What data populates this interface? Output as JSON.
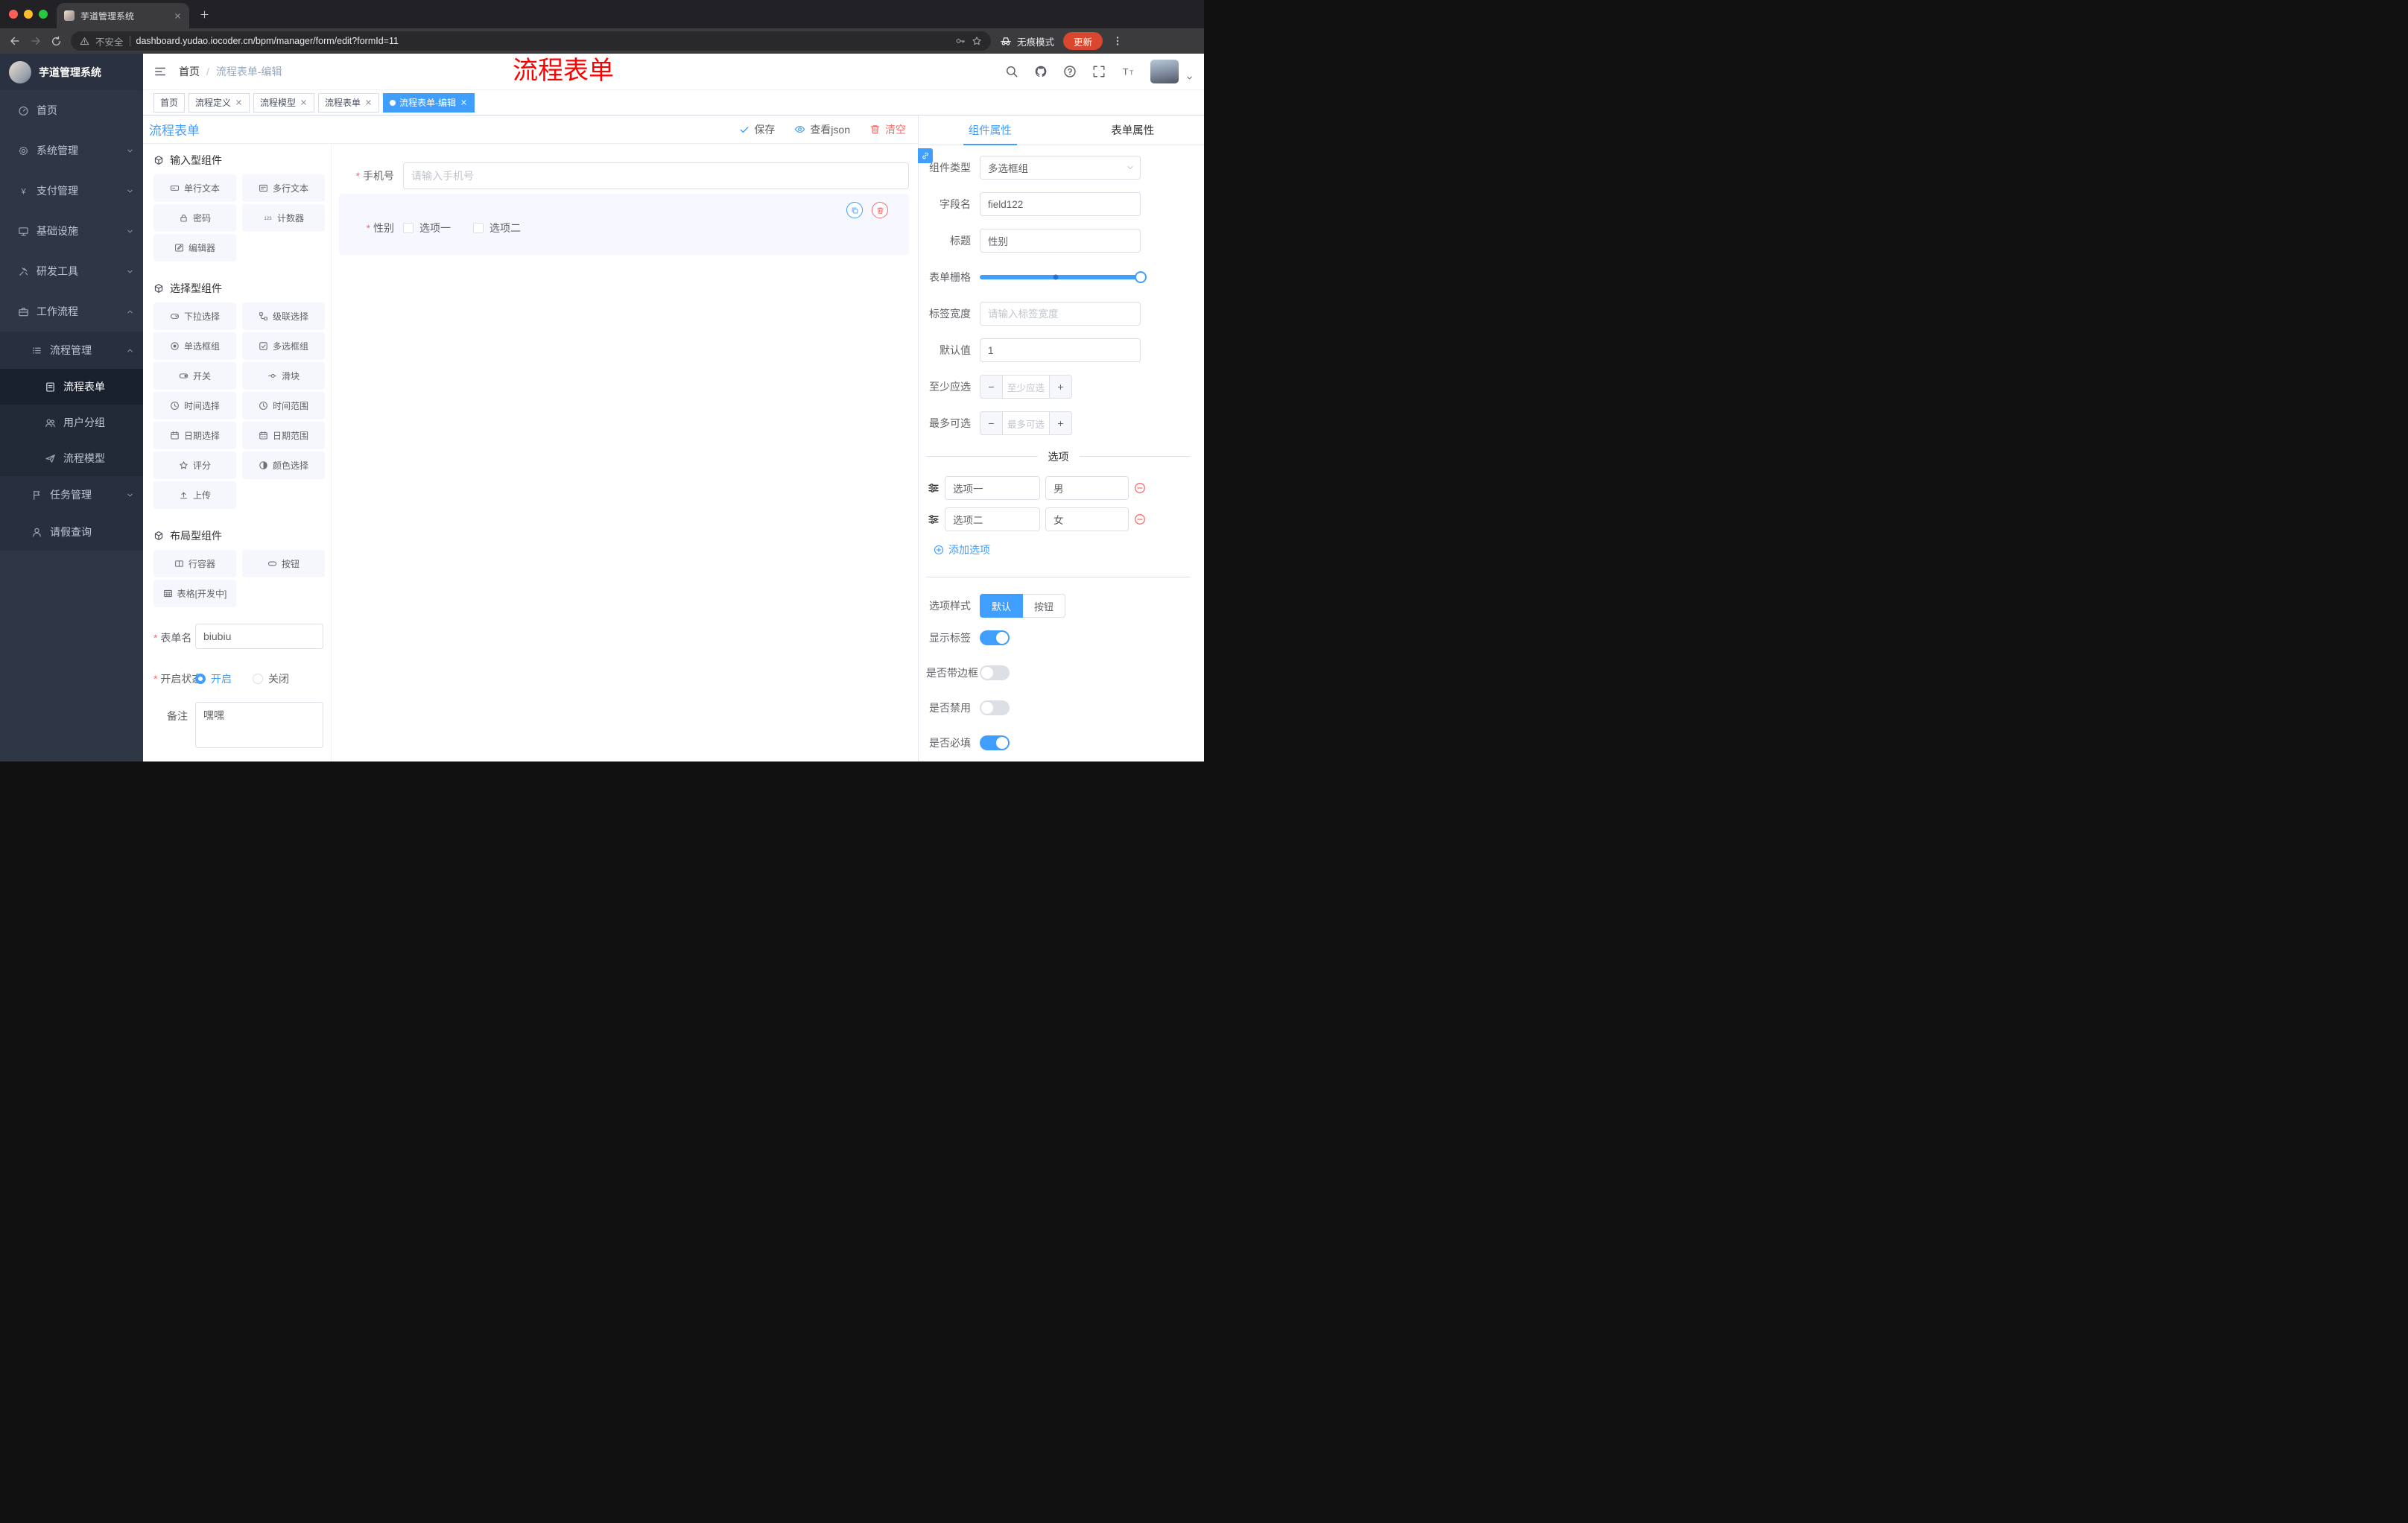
{
  "browser": {
    "tab_title": "芋道管理系统",
    "security_label": "不安全",
    "url": "dashboard.yudao.iocoder.cn/bpm/manager/form/edit?formId=11",
    "incognito_label": "无痕模式",
    "update_label": "更新"
  },
  "sidebar": {
    "logo_title": "芋道管理系统",
    "items": [
      {
        "label": "首页"
      },
      {
        "label": "系统管理"
      },
      {
        "label": "支付管理"
      },
      {
        "label": "基础设施"
      },
      {
        "label": "研发工具"
      },
      {
        "label": "工作流程"
      },
      {
        "label": "流程管理"
      },
      {
        "label": "流程表单"
      },
      {
        "label": "用户分组"
      },
      {
        "label": "流程模型"
      },
      {
        "label": "任务管理"
      },
      {
        "label": "请假查询"
      }
    ]
  },
  "navbar": {
    "breadcrumb_home": "首页",
    "breadcrumb_sep": "/",
    "breadcrumb_current": "流程表单-编辑",
    "annotation": "流程表单",
    "annotation_color": "#fe0000"
  },
  "tags": [
    {
      "label": "首页"
    },
    {
      "label": "流程定义"
    },
    {
      "label": "流程模型"
    },
    {
      "label": "流程表单"
    },
    {
      "label": "流程表单-编辑"
    }
  ],
  "designer": {
    "title": "流程表单",
    "save_label": "保存",
    "view_json_label": "查看json",
    "clear_label": "清空",
    "palette": {
      "section1_title": "输入型组件",
      "section2_title": "选择型组件",
      "section3_title": "布局型组件",
      "s1": [
        "单行文本",
        "多行文本",
        "密码",
        "计数器",
        "编辑器"
      ],
      "s2": [
        "下拉选择",
        "级联选择",
        "单选框组",
        "多选框组",
        "开关",
        "滑块",
        "时间选择",
        "时间范围",
        "日期选择",
        "日期范围",
        "评分",
        "颜色选择",
        "上传"
      ],
      "s3": [
        "行容器",
        "按钮",
        "表格[开发中]"
      ]
    },
    "config": {
      "form_name_label": "表单名",
      "form_name_value": "biubiu",
      "status_label": "开启状态",
      "status_on": "开启",
      "status_off": "关闭",
      "remark_label": "备注",
      "remark_value": "嘿嘿"
    },
    "canvas": {
      "phone_label": "手机号",
      "phone_placeholder": "请输入手机号",
      "gender_label": "性别",
      "gender_option1": "选项一",
      "gender_option2": "选项二"
    }
  },
  "properties": {
    "tab_component": "组件属性",
    "tab_form": "表单属性",
    "component_type_label": "组件类型",
    "component_type_value": "多选框组",
    "field_name_label": "字段名",
    "field_name_value": "field122",
    "title_label": "标题",
    "title_value": "性别",
    "grid_label": "表单栅格",
    "tag_width_label": "标签宽度",
    "tag_width_placeholder": "请输入标签宽度",
    "default_label": "默认值",
    "default_value": "1",
    "min_label": "至少应选",
    "min_placeholder": "至少应选",
    "max_label": "最多可选",
    "max_placeholder": "最多可选",
    "options_divider": "选项",
    "options": [
      {
        "label": "选项一",
        "value": "男"
      },
      {
        "label": "选项二",
        "value": "女"
      }
    ],
    "add_option_label": "添加选项",
    "option_style_label": "选项样式",
    "style_default": "默认",
    "style_button": "按钮",
    "toggle_show_label": "显示标签",
    "toggle_border": "是否带边框",
    "toggle_disabled": "是否禁用",
    "toggle_required": "是否必填"
  },
  "colors": {
    "accent": "#409eff",
    "danger": "#f56c6c"
  }
}
